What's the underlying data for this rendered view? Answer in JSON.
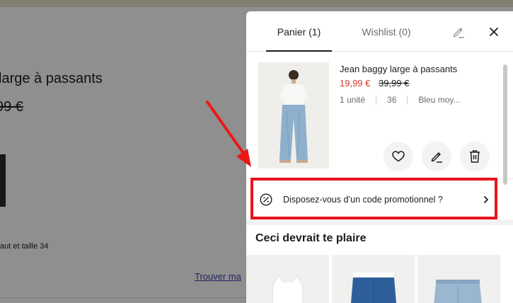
{
  "background": {
    "title": "large à passants",
    "price": "99 €",
    "model_info": "aut et taille 34",
    "link": "Trouver ma"
  },
  "drawer": {
    "tabs": [
      {
        "label": "Panier (1)",
        "active": true
      },
      {
        "label": "Wishlist (0)",
        "active": false
      }
    ],
    "icons": {
      "edit": "pencil-icon",
      "close": "close-icon"
    },
    "item": {
      "name": "Jean baggy large à passants",
      "price_sale": "19,99 €",
      "price_original": "39,99 €",
      "quantity": "1 unité",
      "size": "36",
      "color": "Bleu moy...",
      "actions": [
        "heart-icon",
        "pencil-icon",
        "trash-icon"
      ]
    },
    "promo": {
      "label": "Disposez-vous d’un code promotionnel ?",
      "icon": "percent-badge-icon"
    },
    "recommendations": {
      "title": "Ceci devrait te plaire"
    }
  },
  "colors": {
    "accent_red": "#d9362c",
    "highlight": "#e8141c",
    "overlay": "rgba(0,0,0,0.44)"
  }
}
